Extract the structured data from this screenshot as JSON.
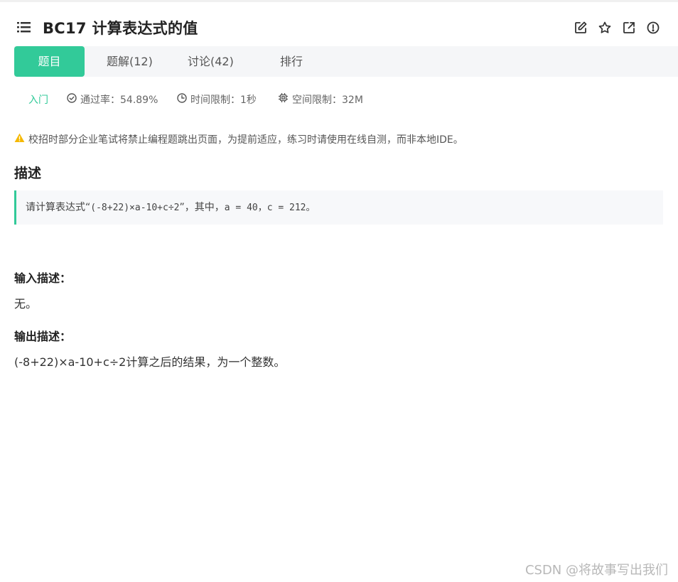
{
  "header": {
    "title": "BC17  计算表达式的值",
    "icons": [
      "menu-list-icon",
      "edit-icon",
      "star-icon",
      "share-icon",
      "report-icon"
    ]
  },
  "tabs": [
    {
      "label": "题目",
      "active": true
    },
    {
      "label": "题解(12)",
      "active": false
    },
    {
      "label": "讨论(42)",
      "active": false
    },
    {
      "label": "排行",
      "active": false
    }
  ],
  "meta": {
    "level": "入门",
    "pass_rate": "通过率：54.89%",
    "time_limit": "时间限制：1秒",
    "space_limit": "空间限制：32M"
  },
  "notice": "校招时部分企业笔试将禁止编程题跳出页面，为提前适应，练习时请使用在线自测，而非本地IDE。",
  "description": {
    "title": "描述",
    "prefix": "请计算表达式“",
    "expression": "(-8+22)×a-10+c÷2",
    "suffix": "”，其中，",
    "values": "a = 40，c = 212。"
  },
  "input": {
    "title": "输入描述：",
    "text": "无。"
  },
  "output": {
    "title": "输出描述：",
    "text": "(-8+22)×a-10+c÷2计算之后的结果，为一个整数。"
  },
  "watermark": "CSDN @将故事写出我们",
  "colors": {
    "accent": "#32ca99",
    "warning": "#f5b800"
  }
}
